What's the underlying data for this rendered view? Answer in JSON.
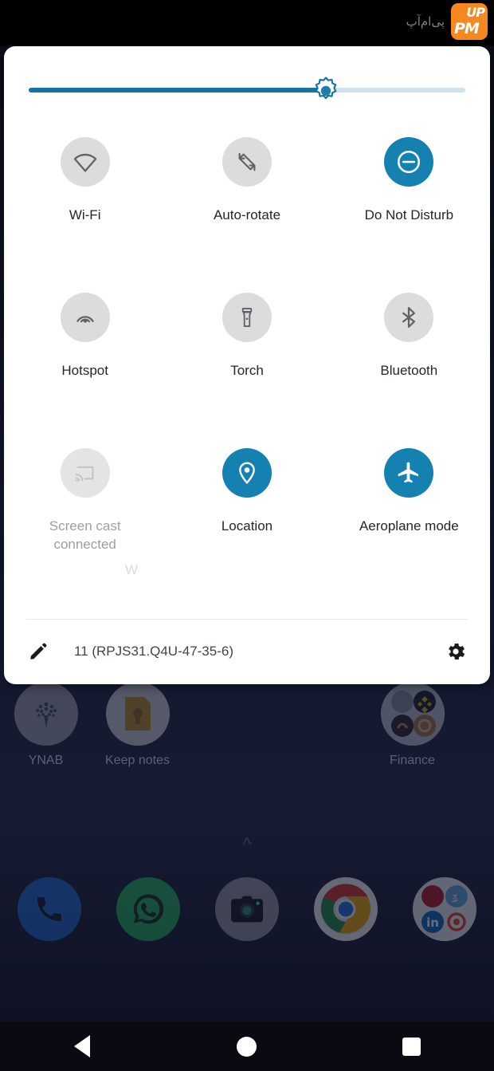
{
  "statusbar": {
    "brand_text_fa": "پی‌ام‌آپ",
    "logo_pm": "PM",
    "logo_up": "UP"
  },
  "quick_settings": {
    "brightness": {
      "name": "brightness-slider",
      "value_percent": 68,
      "icon": "brightness-sun-icon"
    },
    "tiles": [
      [
        {
          "label": "Wi-Fi",
          "icon": "wifi-icon",
          "state": "off"
        },
        {
          "label": "Auto-rotate",
          "icon": "auto-rotate-icon",
          "state": "off"
        },
        {
          "label": "Do Not Disturb",
          "icon": "do-not-disturb-icon",
          "state": "on"
        }
      ],
      [
        {
          "label": "Hotspot",
          "icon": "hotspot-icon",
          "state": "off"
        },
        {
          "label": "Torch",
          "icon": "torch-icon",
          "state": "off"
        },
        {
          "label": "Bluetooth",
          "icon": "bluetooth-icon",
          "state": "off"
        }
      ],
      [
        {
          "label": "Screen cast",
          "sub": "connected",
          "icon": "screen-cast-icon",
          "state": "disabled"
        },
        {
          "label": "Location",
          "icon": "location-pin-icon",
          "state": "on"
        },
        {
          "label": "Aeroplane mode",
          "icon": "aeroplane-icon",
          "state": "on"
        }
      ]
    ],
    "ghost_fragment": "W",
    "footer": {
      "edit_icon": "pencil-edit-icon",
      "build": "11 (RPJS31.Q4U-47-35-6)",
      "settings_icon": "gear-icon"
    }
  },
  "home": {
    "row1": [
      {
        "label": "YNAB",
        "icon": "ynab-tree-icon"
      },
      {
        "label": "Keep notes",
        "icon": "keep-notes-icon"
      },
      {
        "label": "",
        "icon": "empty-slot"
      },
      {
        "label": "",
        "icon": "empty-slot"
      },
      {
        "label": "Finance",
        "icon": "finance-folder-icon"
      }
    ],
    "page_indicator": "chevron-up-icon",
    "dock": [
      {
        "label": "",
        "icon": "phone-icon"
      },
      {
        "label": "",
        "icon": "whatsapp-icon"
      },
      {
        "label": "",
        "icon": "camera-icon"
      },
      {
        "label": "",
        "icon": "chrome-icon"
      },
      {
        "label": "",
        "icon": "social-folder-icon"
      }
    ]
  },
  "navbar": {
    "back": "back-triangle-icon",
    "home": "home-circle-icon",
    "recents": "recents-square-icon"
  },
  "colors": {
    "accent_blue": "#1581b0",
    "tile_off": "#dcdcdc",
    "panel_bg": "#ffffff",
    "brand_orange": "#F5881F"
  }
}
